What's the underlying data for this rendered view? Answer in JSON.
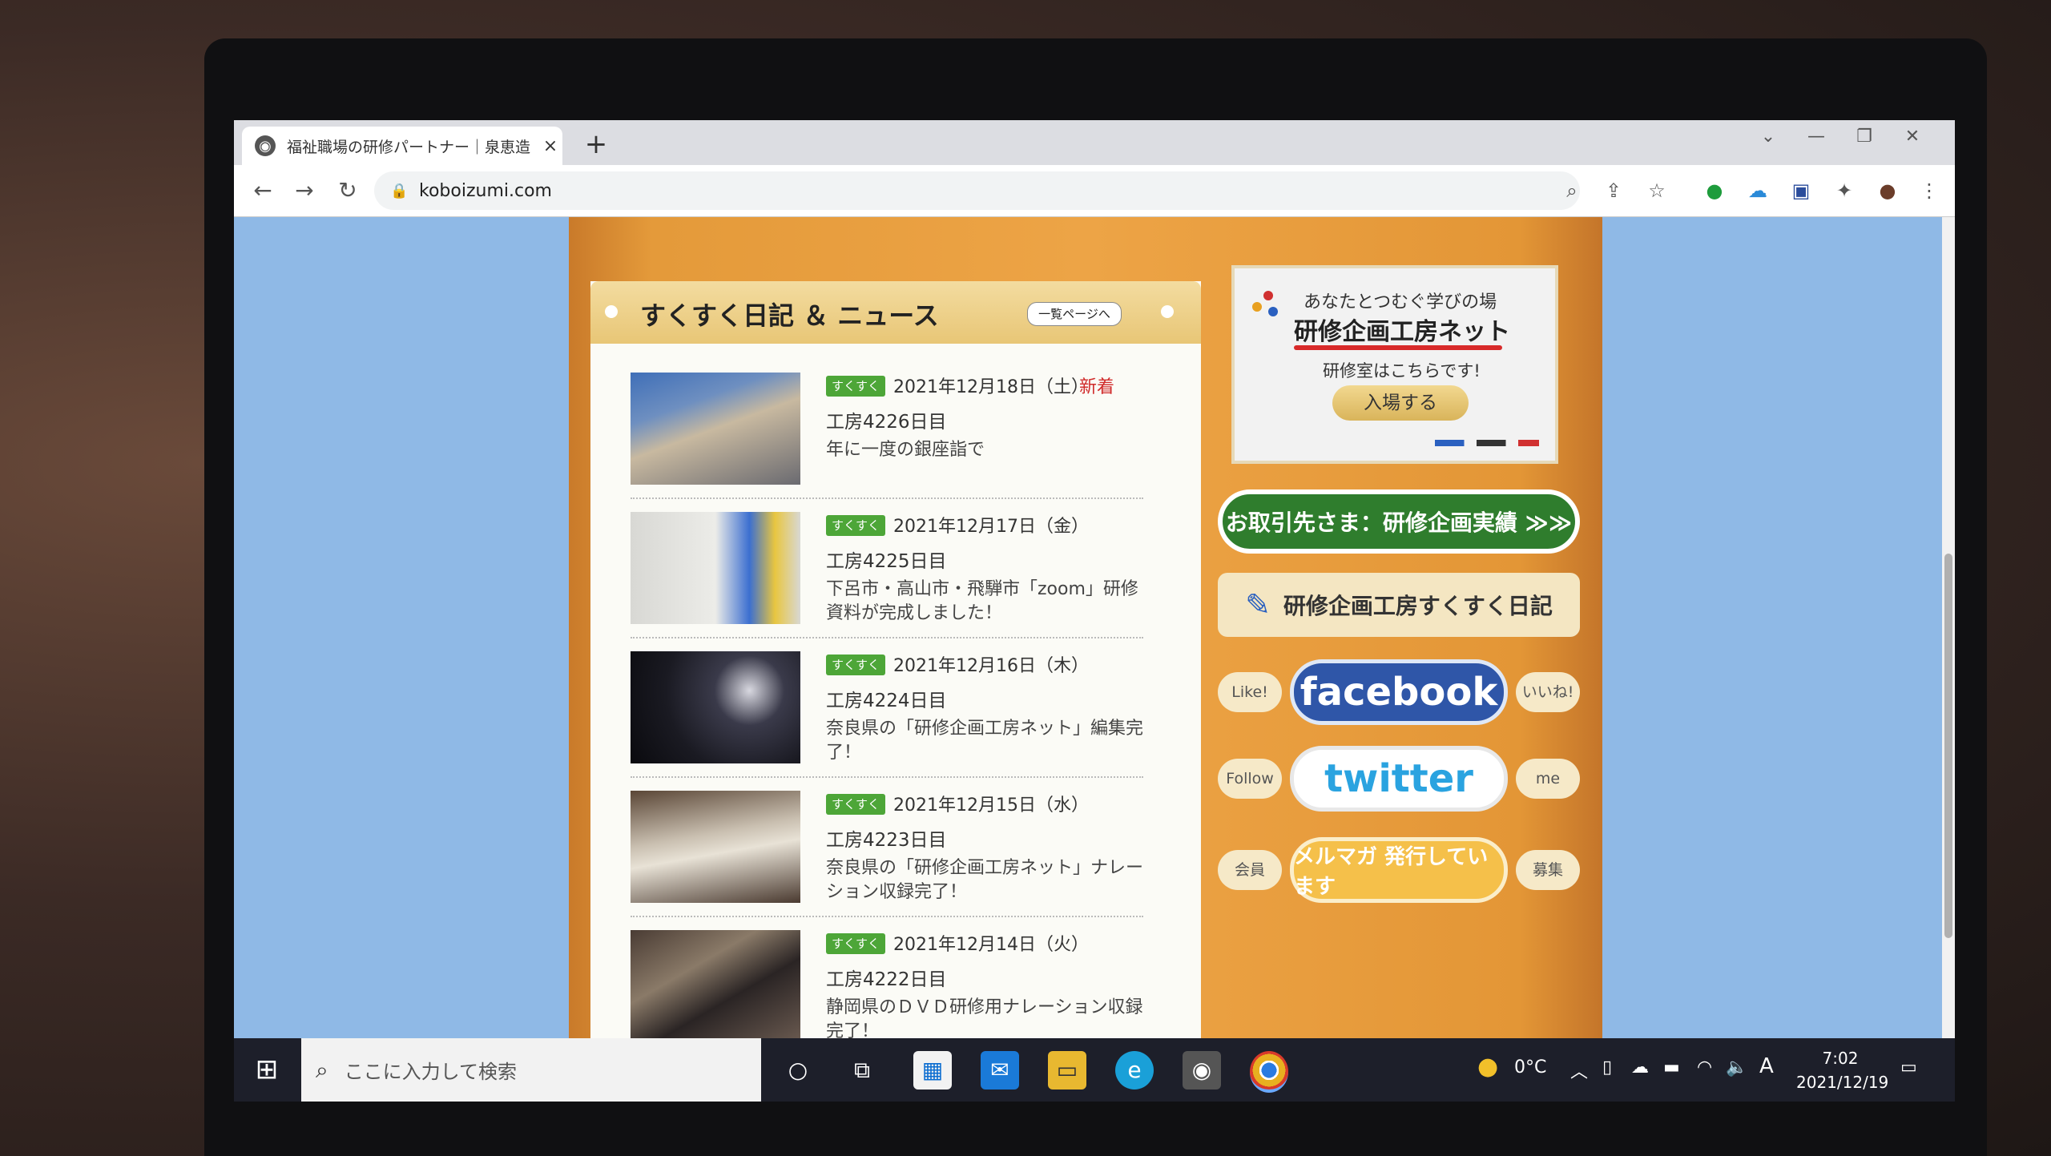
{
  "browser": {
    "tab_title": "福祉職場の研修パートナー｜泉恵造",
    "tab_close": "×",
    "new_tab": "+",
    "url": "koboizumi.com"
  },
  "news": {
    "title": "すくすく日記 ＆ ニュース",
    "more_label": "一覧ページへ",
    "items": [
      {
        "tag": "すくすく",
        "date": "2021年12月18日（土）",
        "new_label": "新着",
        "subtitle": "工房4226日目",
        "desc": "年に一度の銀座詣で"
      },
      {
        "tag": "すくすく",
        "date": "2021年12月17日（金）",
        "subtitle": "工房4225日目",
        "desc": "下呂市・高山市・飛騨市「zoom」研修資料が完成しました！"
      },
      {
        "tag": "すくすく",
        "date": "2021年12月16日（木）",
        "subtitle": "工房4224日目",
        "desc": "奈良県の「研修企画工房ネット」編集完了！"
      },
      {
        "tag": "すくすく",
        "date": "2021年12月15日（水）",
        "subtitle": "工房4223日目",
        "desc": "奈良県の「研修企画工房ネット」ナレーション収録完了！"
      },
      {
        "tag": "すくすく",
        "date": "2021年12月14日（火）",
        "subtitle": "工房4222日目",
        "desc": "静岡県のＤＶＤ研修用ナレーション収録完了！"
      }
    ]
  },
  "sidebar": {
    "banner_line1": "あなたとつむぐ学びの場",
    "banner_line2": "研修企画工房ネット",
    "banner_line3": "研修室はこちらです!",
    "banner_enter": "入場する",
    "jisseki": "お取引先さま：研修企画実績 ≫≫",
    "diary": "研修企画工房すくすく日記",
    "facebook": {
      "left": "Like!",
      "main": "facebook",
      "right": "いいね!"
    },
    "twitter": {
      "left": "Follow",
      "main": "twitter",
      "right": "me"
    },
    "mailmag": {
      "left": "会員",
      "main": "メルマガ 発行しています",
      "right": "募集"
    }
  },
  "taskbar": {
    "search_placeholder": "ここに入力して検索",
    "temperature": "0°C",
    "ime": "A",
    "time": "7:02",
    "date": "2021/12/19"
  }
}
